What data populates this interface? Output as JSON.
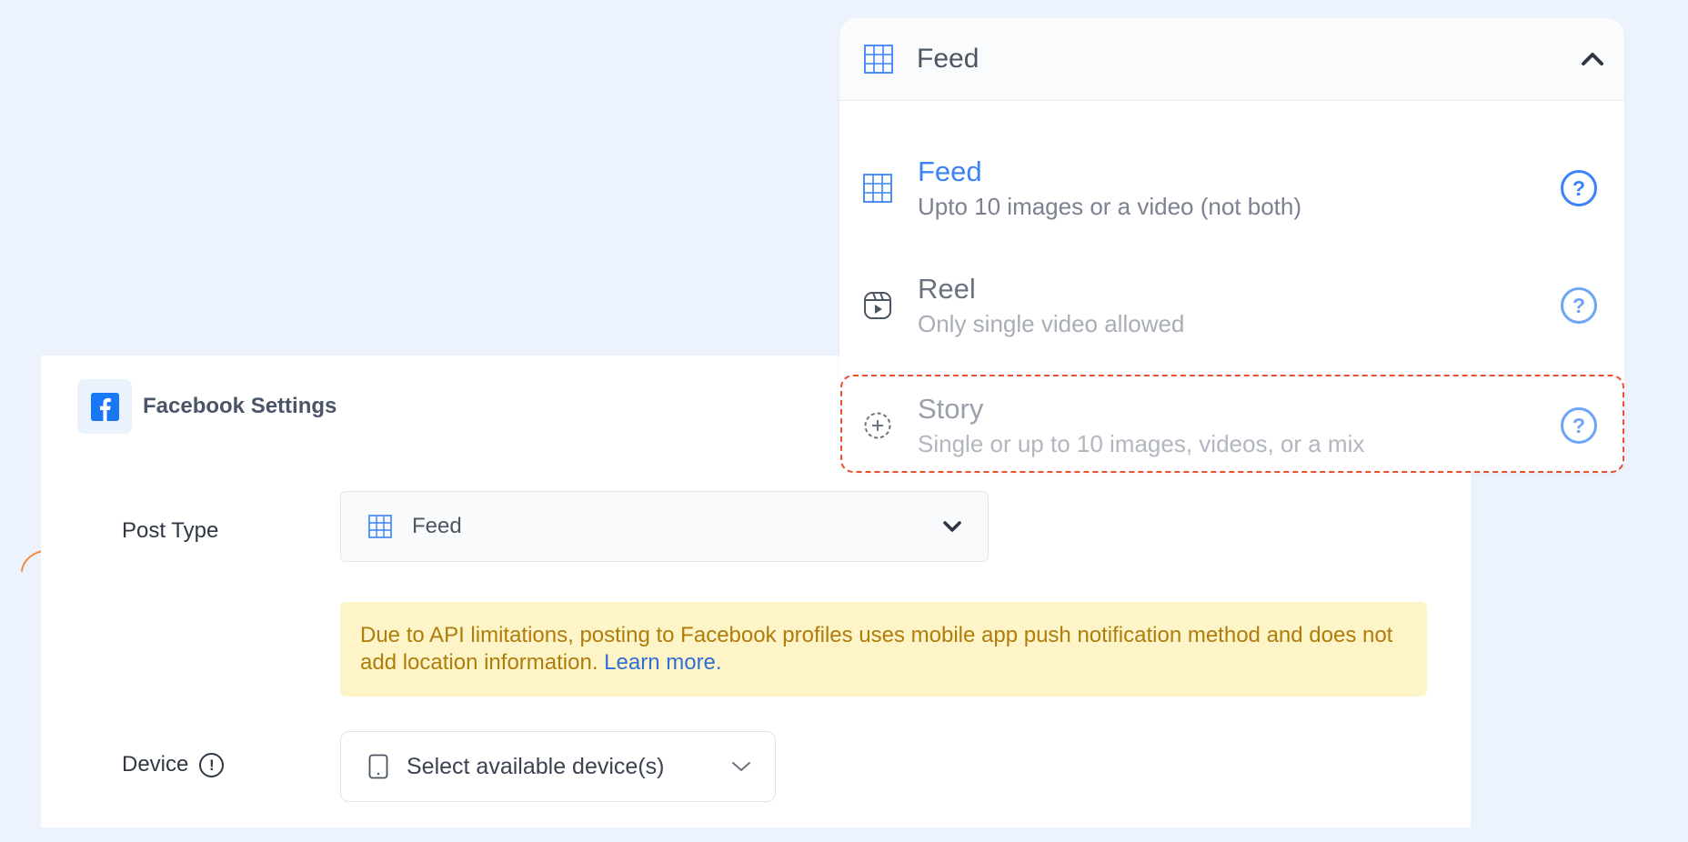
{
  "settings": {
    "header_title": "Facebook Settings",
    "post_type_label": "Post Type",
    "post_type_value": "Feed",
    "alert_text": "Due to API limitations, posting to Facebook profiles uses mobile app push notification method and does not add location information.",
    "alert_link": "Learn more.",
    "device_label": "Device",
    "device_info_glyph": "!",
    "device_placeholder": "Select available device(s)"
  },
  "dropdown": {
    "header_label": "Feed",
    "options": [
      {
        "title": "Feed",
        "desc": "Upto 10 images or a video (not both)",
        "icon": "grid-icon",
        "state": "selected"
      },
      {
        "title": "Reel",
        "desc": "Only single video allowed",
        "icon": "reel-icon",
        "state": "normal"
      },
      {
        "title": "Story",
        "desc": "Single or up to 10 images, videos, or a mix",
        "icon": "story-icon",
        "state": "highlighted"
      }
    ],
    "help_glyph": "?"
  },
  "colors": {
    "background": "#edf3fd",
    "accent_blue": "#3b82f6",
    "facebook_blue": "#1877f2",
    "alert_bg": "#fdf4c8",
    "alert_text": "#b07c0b",
    "highlight_dash": "#ea5030",
    "arrow_orange": "#f28b3c"
  }
}
